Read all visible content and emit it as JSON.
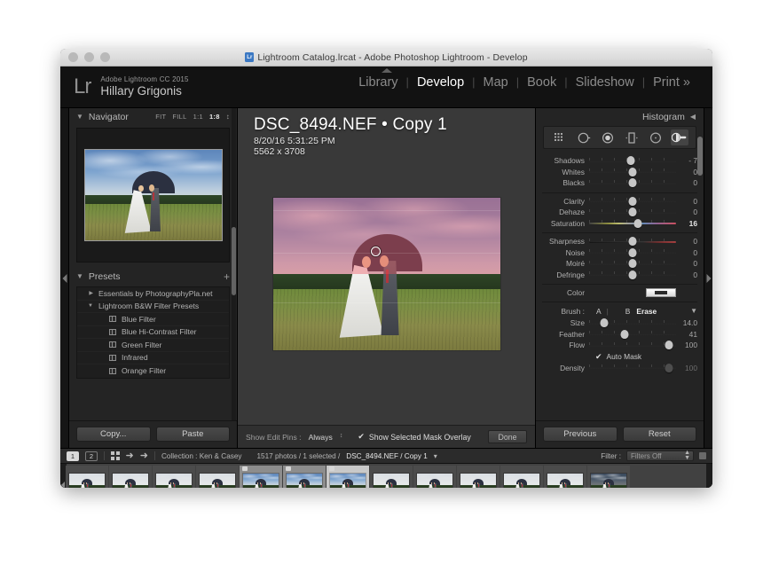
{
  "window": {
    "title": "Lightroom Catalog.lrcat - Adobe Photoshop Lightroom - Develop",
    "app_icon": "lightroom-catalog-icon"
  },
  "identity": {
    "logo": "Lr",
    "product": "Adobe Lightroom CC 2015",
    "user": "Hillary Grigonis"
  },
  "modules": [
    {
      "label": "Library",
      "active": false
    },
    {
      "label": "Develop",
      "active": true
    },
    {
      "label": "Map",
      "active": false
    },
    {
      "label": "Book",
      "active": false
    },
    {
      "label": "Slideshow",
      "active": false
    },
    {
      "label": "Print »",
      "active": false
    }
  ],
  "left_panel": {
    "navigator": {
      "title": "Navigator",
      "caret": "▼",
      "zoom_levels": [
        "FIT",
        "FILL",
        "1:1"
      ],
      "zoom_selected": "1:8",
      "stepper": "↕"
    },
    "presets": {
      "title": "Presets",
      "caret": "▼",
      "add_label": "+",
      "items": [
        {
          "label": "Essentials by PhotographyPla.net",
          "caret": "▶",
          "level": 0,
          "chip": false
        },
        {
          "label": "Lightroom B&W Filter Presets",
          "caret": "▼",
          "level": 0,
          "chip": false
        },
        {
          "label": "Blue Filter",
          "caret": "",
          "level": 1,
          "chip": true
        },
        {
          "label": "Blue Hi-Contrast Filter",
          "caret": "",
          "level": 1,
          "chip": true
        },
        {
          "label": "Green Filter",
          "caret": "",
          "level": 1,
          "chip": true
        },
        {
          "label": "Infrared",
          "caret": "",
          "level": 1,
          "chip": true
        },
        {
          "label": "Orange Filter",
          "caret": "",
          "level": 1,
          "chip": true
        }
      ]
    },
    "buttons": {
      "copy": "Copy...",
      "paste": "Paste"
    }
  },
  "center": {
    "photo_title": "DSC_8494.NEF  •  Copy 1",
    "photo_date": "8/20/16 5:31:25 PM",
    "photo_dimensions": "5562 x 3708",
    "toolbar": {
      "show_edit_pins_label": "Show Edit Pins :",
      "show_edit_pins_value": "Always",
      "stepper": "↕",
      "mask_overlay_checked": "✔",
      "mask_overlay_label": "Show Selected Mask Overlay",
      "done_label": "Done"
    },
    "mask_overlay_color": "#ec5460"
  },
  "right_panel": {
    "histogram_title": "Histogram",
    "histogram_caret": "◀",
    "tools": [
      {
        "name": "crop-overlay-tool",
        "active": false
      },
      {
        "name": "spot-removal-tool",
        "active": false
      },
      {
        "name": "red-eye-correction-tool",
        "active": false
      },
      {
        "name": "graduated-filter-tool",
        "active": false
      },
      {
        "name": "radial-filter-tool",
        "active": false
      },
      {
        "name": "adjustment-brush-tool",
        "active": true
      }
    ],
    "basic_sliders": [
      {
        "label": "Shadows",
        "value": "- 7",
        "pos": 48,
        "rail": "normal",
        "dim": false
      },
      {
        "label": "Whites",
        "value": "0",
        "pos": 50,
        "rail": "normal",
        "dim": false
      },
      {
        "label": "Blacks",
        "value": "0",
        "pos": 50,
        "rail": "normal",
        "dim": false
      }
    ],
    "tone_sliders": [
      {
        "label": "Clarity",
        "value": "0",
        "pos": 50,
        "rail": "normal",
        "dim": false
      },
      {
        "label": "Dehaze",
        "value": "0",
        "pos": 50,
        "rail": "normal",
        "dim": false
      },
      {
        "label": "Saturation",
        "value": "16",
        "pos": 56,
        "rail": "sat",
        "dim": false,
        "bold": true
      }
    ],
    "detail_sliders": [
      {
        "label": "Sharpness",
        "value": "0",
        "pos": 50,
        "rail": "sharp",
        "dim": false
      },
      {
        "label": "Noise",
        "value": "0",
        "pos": 50,
        "rail": "normal",
        "dim": false
      },
      {
        "label": "Moiré",
        "value": "0",
        "pos": 50,
        "rail": "normal",
        "dim": false
      },
      {
        "label": "Defringe",
        "value": "0",
        "pos": 50,
        "rail": "normal",
        "dim": false
      }
    ],
    "color_row": {
      "label": "Color",
      "swatch": "color-swatch"
    },
    "brush": {
      "label": "Brush :",
      "a": "A",
      "divider": "|",
      "b": "B",
      "erase": "Erase",
      "caret": "▼",
      "sliders": [
        {
          "label": "Size",
          "value": "14.0",
          "pos": 17,
          "rail": "normal",
          "dim": false
        },
        {
          "label": "Feather",
          "value": "41",
          "pos": 41,
          "rail": "normal",
          "dim": false
        },
        {
          "label": "Flow",
          "value": "100",
          "pos": 92,
          "rail": "normal",
          "dim": false
        }
      ],
      "auto_mask_checked": "✔",
      "auto_mask_label": "Auto Mask",
      "density": {
        "label": "Density",
        "value": "100",
        "pos": 92,
        "rail": "normal",
        "dim": true
      }
    },
    "buttons": {
      "previous": "Previous",
      "reset": "Reset"
    }
  },
  "filmstrip": {
    "page_buttons": [
      "1",
      "2"
    ],
    "page_active": "1",
    "grid_icon": "grid-view-icon",
    "back_icon": "back-arrow-icon",
    "forward_icon": "forward-arrow-icon",
    "collection_label": "Collection : Ken & Casey",
    "counts": "1517 photos / 1 selected /",
    "current_file": "DSC_8494.NEF / Copy 1",
    "path_caret": "▾",
    "filter_label": "Filter :",
    "filter_value": "Filters Off",
    "thumbs": [
      {
        "style": "flat",
        "selected": false,
        "lit": false,
        "badges": false,
        "flag": false
      },
      {
        "style": "flat",
        "selected": false,
        "lit": false,
        "badges": false,
        "flag": false
      },
      {
        "style": "flat",
        "selected": false,
        "lit": false,
        "badges": false,
        "flag": false
      },
      {
        "style": "flat",
        "selected": false,
        "lit": false,
        "badges": false,
        "flag": false
      },
      {
        "style": "color",
        "selected": false,
        "lit": true,
        "badges": true,
        "flag": true
      },
      {
        "style": "color",
        "selected": false,
        "lit": true,
        "badges": false,
        "flag": true
      },
      {
        "style": "color",
        "selected": true,
        "lit": false,
        "badges": true,
        "flag": true
      },
      {
        "style": "flat",
        "selected": false,
        "lit": false,
        "badges": false,
        "flag": false
      },
      {
        "style": "flat",
        "selected": false,
        "lit": false,
        "badges": false,
        "flag": false
      },
      {
        "style": "flat",
        "selected": false,
        "lit": false,
        "badges": false,
        "flag": false
      },
      {
        "style": "flat",
        "selected": false,
        "lit": false,
        "badges": false,
        "flag": false
      },
      {
        "style": "flat",
        "selected": false,
        "lit": false,
        "badges": false,
        "flag": false
      },
      {
        "style": "dark",
        "selected": false,
        "lit": false,
        "badges": false,
        "flag": false
      }
    ]
  }
}
